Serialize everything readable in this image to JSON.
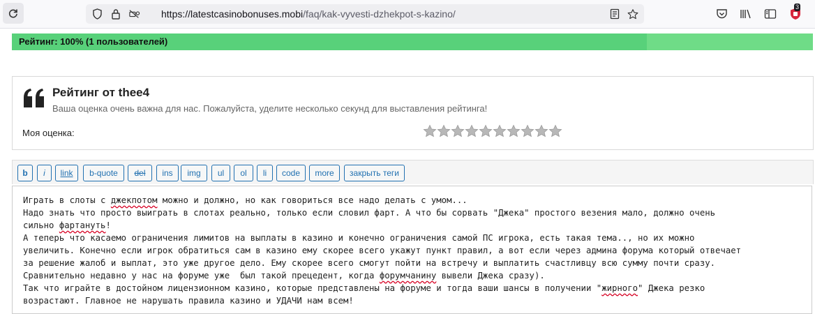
{
  "browser": {
    "url_host": "https://latestcasinobonuses.mobi",
    "url_path": "/faq/kak-vyvesti-dzhekpot-s-kazino/",
    "extensions_badge": "3"
  },
  "rating": {
    "label": "Рейтинг: 100% (1 пользователей)",
    "percent": 100
  },
  "review": {
    "title": "Рейтинг от thee4",
    "subtitle": "Ваша оценка очень важна для нас. Пожалуйста, уделите несколько секунд для выставления рейтинга!",
    "my_rating_label": "Моя оценка:",
    "stars_total": 10,
    "stars_selected": 0
  },
  "editor": {
    "buttons": [
      "b",
      "i",
      "link",
      "b-quote",
      "del",
      "ins",
      "img",
      "ul",
      "ol",
      "li",
      "code",
      "more",
      "закрыть теги"
    ],
    "lines": [
      [
        "Играть в слоты с ",
        {
          "t": "джекпотом",
          "sp": true
        },
        " можно и должно, но как говориться все надо делать с умом..."
      ],
      [
        "Надо знать что просто выиграть в слотах реально, только если словил фарт. А что бы сорвать \"Джека\" простого везения мало, должно очень"
      ],
      [
        "сильно ",
        {
          "t": "фартануть",
          "sp": true
        },
        "!"
      ],
      [
        "А теперь что касаемо ограничения лимитов на выплаты в казино и конечно ограничения самой ПС игрока, есть такая тема.., но их можно"
      ],
      [
        "увеличить. Конечно если игрок обратиться сам в казино ему скорее всего укажут пункт правил, а вот если через админа форума который отвечает"
      ],
      [
        "за решение жалоб и выплат, это уже другое дело. Ему скорее всего смогут пойти на встречу и выплатить счастливцу всю сумму почти сразу."
      ],
      [
        "Сравнительно недавно у нас на форуме уже  был такой прецедент, когда ",
        {
          "t": "форумчанину",
          "sp": true
        },
        " вывели Джека сразу)."
      ],
      [
        "Так что играйте в достойном лицензионном казино, которые представлены на форуме и тогда ваши шансы в получении \"",
        {
          "t": "жирного",
          "sp": true
        },
        "\" Джека резко"
      ],
      [
        "возрастают. Главное не нарушать правила казино и УДАЧИ нам всем!"
      ]
    ]
  }
}
